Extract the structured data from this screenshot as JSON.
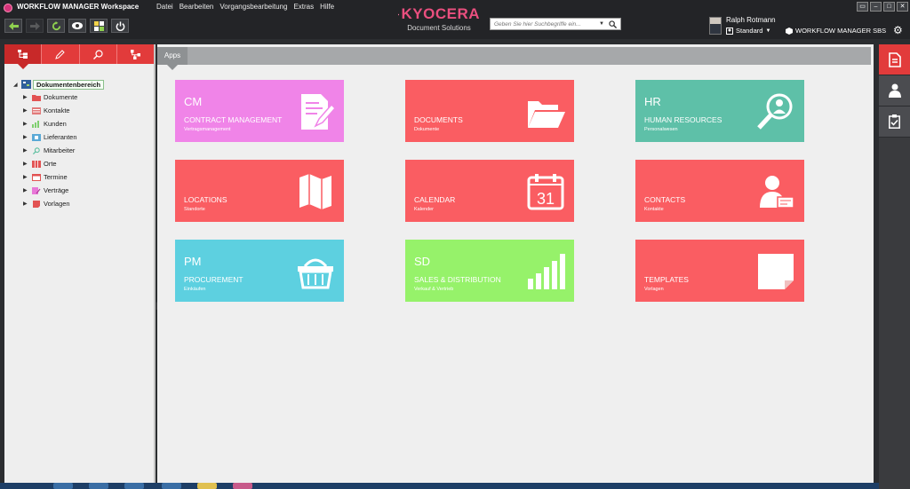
{
  "window": {
    "title": "WORKFLOW MANAGER Workspace",
    "controls": [
      "minimize",
      "restore",
      "maximize",
      "close"
    ]
  },
  "menu": [
    "Datei",
    "Bearbeiten",
    "Vorgangsbearbeitung",
    "Extras",
    "Hilfe"
  ],
  "toolbar": {
    "buttons": [
      "back-icon",
      "forward-icon",
      "refresh-icon",
      "view-icon",
      "workflow-icon",
      "power-icon"
    ]
  },
  "brand": {
    "name": "KYOCERA",
    "subtitle": "Document Solutions",
    "color": "#ea4f7f"
  },
  "search": {
    "placeholder": "Geben Sie hier Suchbegriffe ein..."
  },
  "user": {
    "name": "Ralph Rotmann",
    "profile": "Standard",
    "workspace": "WORKFLOW MANAGER SBS"
  },
  "left_tabs": [
    "tree-icon",
    "pen-icon",
    "search-tool-icon",
    "network-icon"
  ],
  "tree": {
    "root": "Dokumentenbereich",
    "items": [
      {
        "label": "Dokumente",
        "icon": "folder-icon",
        "color": "#e25252"
      },
      {
        "label": "Kontakte",
        "icon": "contacts-icon",
        "color": "#e27a7a"
      },
      {
        "label": "Kunden",
        "icon": "customers-icon",
        "color": "#7fcf6f"
      },
      {
        "label": "Lieferanten",
        "icon": "suppliers-icon",
        "color": "#5aa9d6"
      },
      {
        "label": "Mitarbeiter",
        "icon": "employees-icon",
        "color": "#5bbf9f"
      },
      {
        "label": "Orte",
        "icon": "map-icon",
        "color": "#e25252"
      },
      {
        "label": "Termine",
        "icon": "calendar-icon",
        "color": "#e25252"
      },
      {
        "label": "Verträge",
        "icon": "contract-icon",
        "color": "#e878d8"
      },
      {
        "label": "Vorlagen",
        "icon": "template-icon",
        "color": "#e25252"
      }
    ]
  },
  "main": {
    "tab": "Apps",
    "tiles": [
      {
        "abbr": "CM",
        "name": "CONTRACT MANAGEMENT",
        "sub": "Vertragsmanagement",
        "color": "#f084e8",
        "icon": "contract-icon"
      },
      {
        "abbr": "",
        "name": "DOCUMENTS",
        "sub": "Dokumente",
        "color": "#fa5d62",
        "icon": "folder-open-icon"
      },
      {
        "abbr": "HR",
        "name": "HUMAN RESOURCES",
        "sub": "Personalwesen",
        "color": "#5ec0a8",
        "icon": "person-search-icon"
      },
      {
        "abbr": "",
        "name": "LOCATIONS",
        "sub": "Standorte",
        "color": "#fa5d62",
        "icon": "map-icon"
      },
      {
        "abbr": "",
        "name": "CALENDAR",
        "sub": "Kalender",
        "color": "#fa5d62",
        "icon": "calendar-icon",
        "icon_text": "31"
      },
      {
        "abbr": "",
        "name": "CONTACTS",
        "sub": "Kontakte",
        "color": "#fa5d62",
        "icon": "contact-card-icon"
      },
      {
        "abbr": "PM",
        "name": "PROCUREMENT",
        "sub": "Einkäufen",
        "color": "#5dd0e0",
        "icon": "basket-icon"
      },
      {
        "abbr": "SD",
        "name": "SALES & DISTRIBUTION",
        "sub": "Verkauf & Vertrieb",
        "color": "#96f26a",
        "icon": "bar-chart-icon"
      },
      {
        "abbr": "",
        "name": "TEMPLATES",
        "sub": "Vorlagen",
        "color": "#fa5d62",
        "icon": "note-icon"
      }
    ]
  },
  "right_bar": [
    "document-icon",
    "user-icon",
    "clipboard-check-icon"
  ]
}
